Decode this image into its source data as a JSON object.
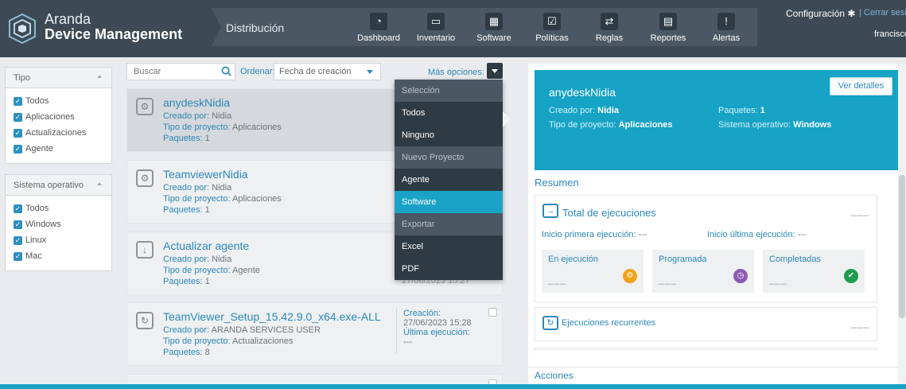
{
  "brand": {
    "line1": "Aranda",
    "line2": "Device Management"
  },
  "module": "Distribución",
  "nav": [
    {
      "label": "Dashboard",
      "icon": "speedometer-icon",
      "glyph": "◔"
    },
    {
      "label": "Inventario",
      "icon": "computer-icon",
      "glyph": "▭"
    },
    {
      "label": "Software",
      "icon": "grid-icon",
      "glyph": "▦"
    },
    {
      "label": "Políticas",
      "icon": "checklist-icon",
      "glyph": "☑"
    },
    {
      "label": "Reglas",
      "icon": "rules-icon",
      "glyph": "⇄"
    },
    {
      "label": "Reportes",
      "icon": "report-icon",
      "glyph": "▤"
    },
    {
      "label": "Alertas",
      "icon": "warning-icon",
      "glyph": "!"
    }
  ],
  "user_bar": {
    "config": "Configuración",
    "logout": "Cerrar sesión",
    "username": "francisco"
  },
  "filters": {
    "tipo": {
      "title": "Tipo",
      "options": [
        "Todos",
        "Aplicaciones",
        "Actualizaciones",
        "Agente"
      ]
    },
    "so": {
      "title": "Sistema operativo",
      "options": [
        "Todos",
        "Windows",
        "Linux",
        "Mac"
      ]
    }
  },
  "toolbar": {
    "search_placeholder": "Buscar",
    "order_label": "Ordenar:",
    "order_value": "Fecha de creación",
    "more_label": "Más opciones:"
  },
  "cards": [
    {
      "title": "anydeskNidia",
      "icon": "gear-box-icon",
      "glyph": "⚙",
      "created_label": "Creado por:",
      "created": "Nidia",
      "type_label": "Tipo de proyecto:",
      "type": "Aplicaciones",
      "packages_label": "Paquetes:",
      "packages": "1"
    },
    {
      "title": "TeamviewerNidia",
      "icon": "gear-box-icon",
      "glyph": "⚙",
      "created_label": "Creado por:",
      "created": "Nidia",
      "type_label": "Tipo de proyecto:",
      "type": "Aplicaciones",
      "packages_label": "Paquetes:",
      "packages": "1"
    },
    {
      "title": "Actualizar agente",
      "icon": "download-box-icon",
      "glyph": "↓",
      "created_label": "Creado por:",
      "created": "Nidia",
      "type_label": "Tipo de proyecto:",
      "type": "Agente",
      "packages_label": "Paquetes:",
      "packages": "1",
      "partial": "27/06/2023 15:27"
    },
    {
      "title": "TeamViewer_Setup_15.42.9.0_x64.exe-ALL",
      "icon": "refresh-box-icon",
      "glyph": "↻",
      "created_label": "Creado por:",
      "created": "ARANDA SERVICES USER",
      "type_label": "Tipo de proyecto:",
      "type": "Actualizaciones",
      "packages_label": "Paquetes:",
      "packages": "8",
      "creation_label": "Creación:",
      "creation": "27/06/2023 15:28",
      "last_label": "Última ejecución:",
      "last": "---"
    }
  ],
  "menu": [
    {
      "label": "Selección",
      "kind": "section"
    },
    {
      "label": "Todos",
      "kind": "item"
    },
    {
      "label": "Ninguno",
      "kind": "item"
    },
    {
      "label": "Nuevo Proyecto",
      "kind": "section"
    },
    {
      "label": "Agente",
      "kind": "item"
    },
    {
      "label": "Software",
      "kind": "active"
    },
    {
      "label": "Exportar",
      "kind": "section"
    },
    {
      "label": "Excel",
      "kind": "item"
    },
    {
      "label": "PDF",
      "kind": "item"
    }
  ],
  "detail": {
    "title": "anydeskNidia",
    "details_button": "Ver detalles",
    "created_label": "Creado por:",
    "created": "Nidia",
    "type_label": "Tipo de proyecto:",
    "type": "Aplicaciones",
    "packages_label": "Paquetes:",
    "packages": "1",
    "os_label": "Sistema operativo:",
    "os": "Windows",
    "summary": "Resumen",
    "exec_title": "Total de ejecuciones",
    "dash": "___",
    "first_label": "Inicio primera ejecución:",
    "first": "---",
    "last_label": "Inicio última ejecución:",
    "last": "---",
    "stats": [
      {
        "label": "En ejecución",
        "value": "___",
        "color": "#f0a31a",
        "icon": "gears-icon",
        "glyph": "⚙"
      },
      {
        "label": "Programada",
        "value": "___",
        "color": "#8e5bb5",
        "icon": "clock-icon",
        "glyph": "◷"
      },
      {
        "label": "Completadas",
        "value": "___",
        "color": "#1e9e4e",
        "icon": "check-icon",
        "glyph": "✔"
      }
    ],
    "recurrent": "Ejecuciones recurrentes",
    "actions": "Acciones"
  }
}
